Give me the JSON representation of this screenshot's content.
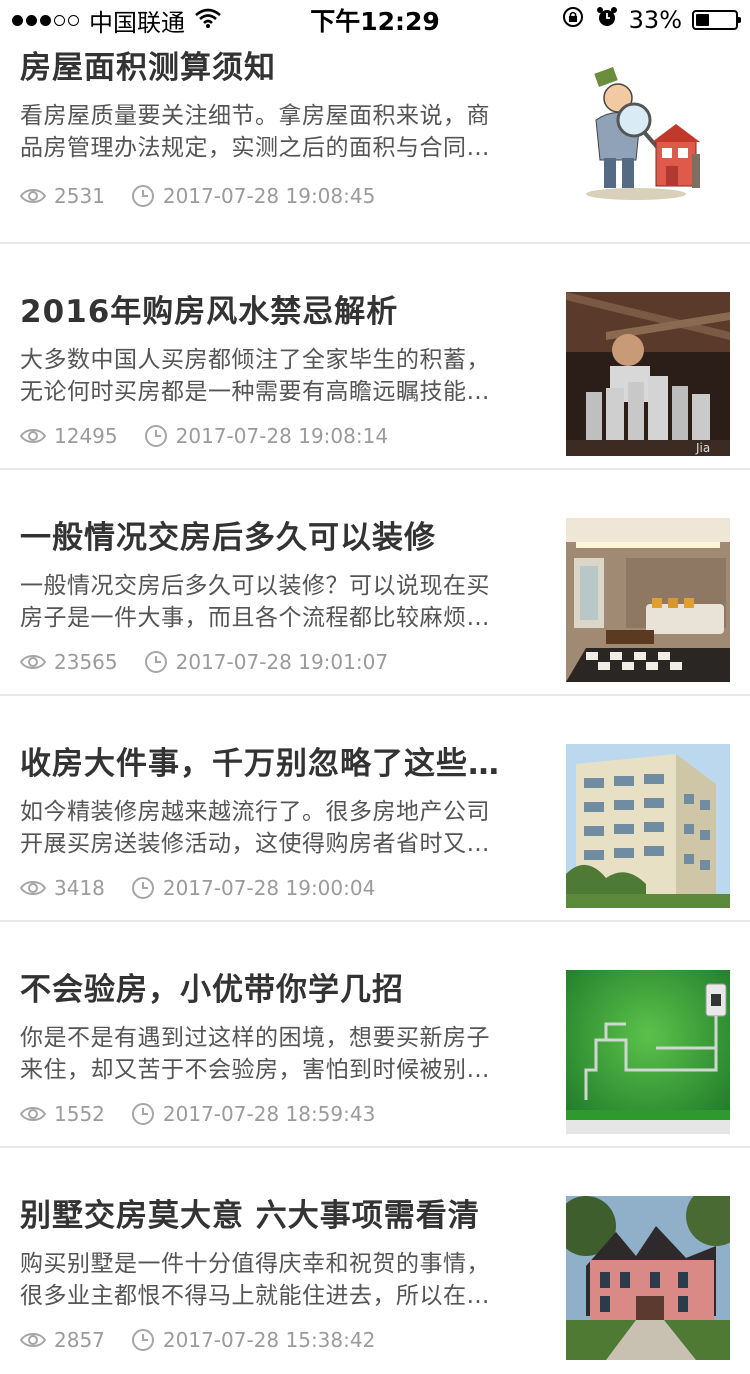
{
  "status": {
    "carrier": "中国联通",
    "time": "下午12:29",
    "battery": "33%",
    "battery_level": 0.33
  },
  "articles": [
    {
      "title": "房屋面积测算须知",
      "desc": "看房屋质量要关注细节。拿房屋面积来说，商品房管理办法规定，实测之后的面积与合同…",
      "views": "2531",
      "time": "2017-07-28 19:08:45",
      "thumb": "cartoon-inspector"
    },
    {
      "title": "2016年购房风水禁忌解析",
      "desc": "大多数中国人买房都倾注了全家毕生的积蓄，无论何时买房都是一种需要有高瞻远瞩技能…",
      "views": "12495",
      "time": "2017-07-28 19:08:14",
      "thumb": "man-with-model"
    },
    {
      "title": "一般情况交房后多久可以装修",
      "desc": "一般情况交房后多久可以装修？可以说现在买房子是一件大事，而且各个流程都比较麻烦…",
      "views": "23565",
      "time": "2017-07-28 19:01:07",
      "thumb": "living-room"
    },
    {
      "title": "收房大件事，千万别忽略了这些…",
      "desc": "如今精装修房越来越流行了。很多房地产公司开展买房送装修活动，这使得购房者省时又…",
      "views": "3418",
      "time": "2017-07-28 19:00:04",
      "thumb": "apartment-building"
    },
    {
      "title": "不会验房，小优带你学几招",
      "desc": "你是不是有遇到过这样的困境，想要买新房子来住，却又苦于不会验房，害怕到时候被别…",
      "views": "1552",
      "time": "2017-07-28 18:59:43",
      "thumb": "green-wall-pipes"
    },
    {
      "title": "别墅交房莫大意 六大事项需看清",
      "desc": "购买别墅是一件十分值得庆幸和祝贺的事情，很多业主都恨不得马上就能住进去，所以在…",
      "views": "2857",
      "time": "2017-07-28 15:38:42",
      "thumb": "pink-villa"
    }
  ]
}
